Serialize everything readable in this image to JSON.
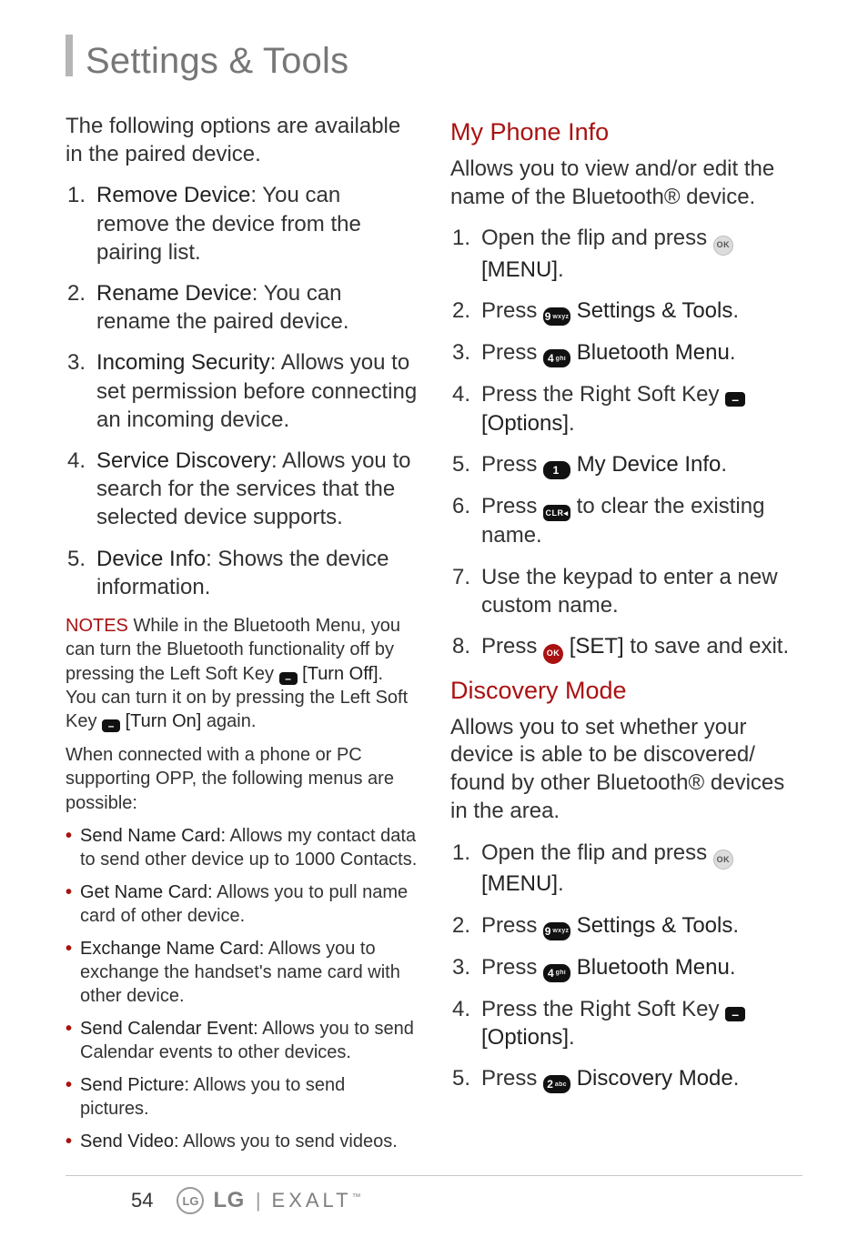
{
  "page_title": "Settings & Tools",
  "page_number": "54",
  "brand": {
    "lg": "LG",
    "model": "EXALT",
    "badge": "LG"
  },
  "left": {
    "intro": "The following options are available in the paired device.",
    "options": [
      {
        "n": "1.",
        "name": "Remove Device",
        "desc": ": You can remove the device from the pairing list."
      },
      {
        "n": "2.",
        "name": "Rename Device",
        "desc": ": You can rename the paired device."
      },
      {
        "n": "3.",
        "name": "Incoming Security",
        "desc": ": Allows you to set permission before connecting an incoming device."
      },
      {
        "n": "4.",
        "name": "Service Discovery",
        "desc": ": Allows you to search for the services that the selected device supports."
      },
      {
        "n": "5.",
        "name": "Device Info",
        "desc": ": Shows the device information."
      }
    ],
    "notes_label": "NOTES",
    "notes_p1a": "While in the Bluetooth Menu, you can turn the Bluetooth functionality off by pressing the Left Soft Key ",
    "notes_p1b": "[Turn Off]",
    "notes_p1c": ". You can turn it on by pressing the Left Soft Key ",
    "notes_p1d": "[Turn On]",
    "notes_p1e": " again.",
    "notes_p2": "When connected with a phone or PC supporting OPP, the following menus are possible:",
    "bullets": [
      {
        "name": "Send Name Card:",
        "desc": " Allows my contact data to send other device up to 1000 Contacts."
      },
      {
        "name": "Get Name Card:",
        "desc": " Allows you to pull name card of other device."
      },
      {
        "name": "Exchange Name Card:",
        "desc": " Allows you to exchange the handset's name card with other device."
      },
      {
        "name": "Send Calendar Event:",
        "desc": " Allows you to send Calendar events to other devices."
      },
      {
        "name": "Send Picture:",
        "desc": " Allows you to send pictures."
      },
      {
        "name": "Send Video:",
        "desc": " Allows you to send videos."
      }
    ]
  },
  "right": {
    "my_phone_info": {
      "heading": "My Phone Info",
      "intro": "Allows you to view and/or edit the name of the Bluetooth® device.",
      "steps": {
        "s1a": "Open the flip and press ",
        "s1b": "[MENU]",
        "s1c": ".",
        "s2a": "Press ",
        "s2b": "Settings & Tools",
        "s2c": ".",
        "s3a": "Press ",
        "s3b": "Bluetooth Menu",
        "s3c": ".",
        "s4a": "Press the Right Soft Key ",
        "s4b": "[Options]",
        "s4c": ".",
        "s5a": "Press ",
        "s5b": "My Device Info",
        "s5c": ".",
        "s6a": "Press ",
        "s6b": " to clear the existing name.",
        "s7": "Use the keypad to enter a new custom name.",
        "s8a": "Press ",
        "s8b": "[SET]",
        "s8c": " to save and exit."
      }
    },
    "discovery_mode": {
      "heading": "Discovery Mode",
      "intro": "Allows you to set whether your device is able to be discovered/ found by other Bluetooth® devices in the area.",
      "steps": {
        "s1a": "Open the flip and press ",
        "s1b": "[MENU]",
        "s1c": ".",
        "s2a": "Press ",
        "s2b": "Settings & Tools",
        "s2c": ".",
        "s3a": "Press ",
        "s3b": "Bluetooth Menu",
        "s3c": ".",
        "s4a": "Press the Right Soft Key ",
        "s4b": "[Options]",
        "s4c": ".",
        "s5a": "Press ",
        "s5b": "Discovery Mode",
        "s5c": "."
      }
    }
  },
  "keys": {
    "softkey_minus": "–",
    "ok": "OK",
    "clr": "CLR◂",
    "k9n": "9",
    "k9l": "wxyz",
    "k4n": "4",
    "k4l": "ghi",
    "k1n": "1",
    "k1l": "",
    "k2n": "2",
    "k2l": "abc"
  }
}
